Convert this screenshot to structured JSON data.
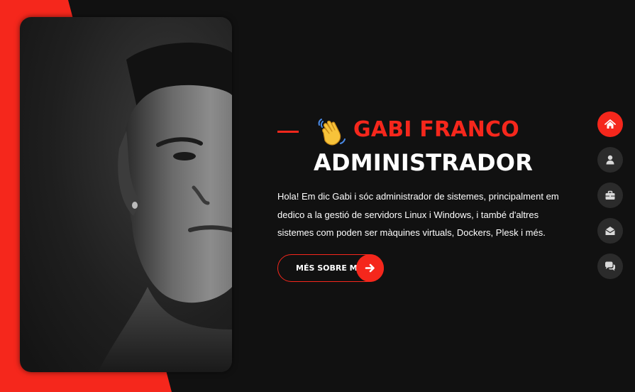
{
  "hero": {
    "name": "GABI FRANCO",
    "role": "ADMINISTRADOR",
    "bio": "Hola! Em dic Gabi i sóc administrador de sistemes, principalment em dedico a la gestió de servidors Linux i Windows, i també d'altres sistemes com poden ser màquines virtuals, Dockers, Plesk i més.",
    "button_label": "MÉS SOBRE MI",
    "greeting_icon": "waving-hand-emoji",
    "button_icon": "arrow-right-icon"
  },
  "nav": {
    "items": [
      {
        "icon": "home-icon",
        "active": true
      },
      {
        "icon": "user-icon",
        "active": false
      },
      {
        "icon": "briefcase-icon",
        "active": false
      },
      {
        "icon": "envelope-open-icon",
        "active": false
      },
      {
        "icon": "comments-icon",
        "active": false
      }
    ]
  },
  "colors": {
    "accent": "#f5271c",
    "background": "#111111",
    "nav_inactive": "#2b2b2b",
    "text": "#ffffff"
  }
}
